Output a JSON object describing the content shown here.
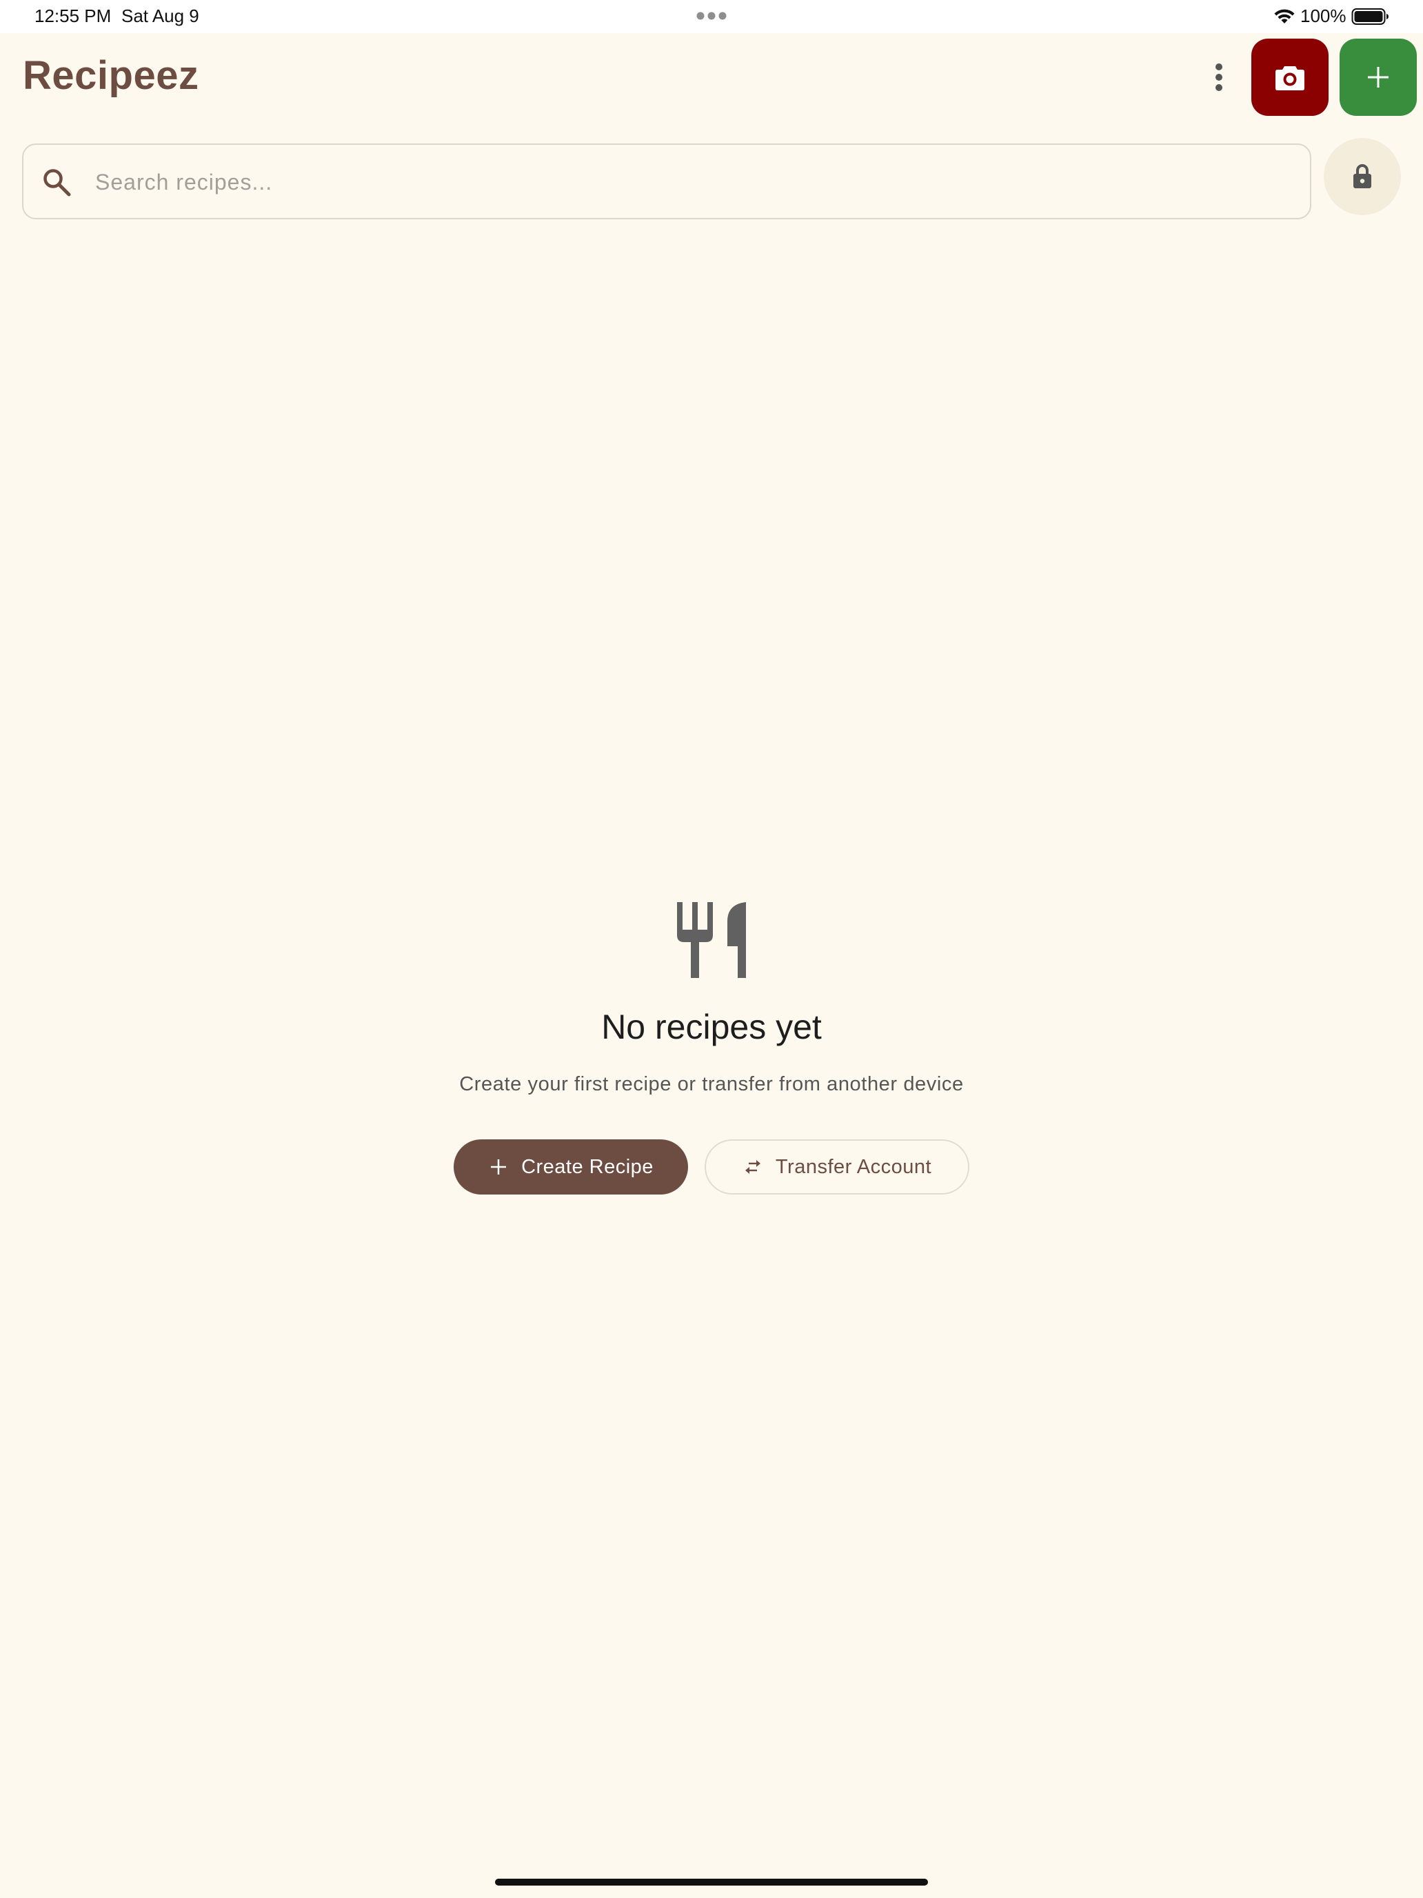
{
  "status_bar": {
    "time": "12:55 PM",
    "date": "Sat Aug 9",
    "battery_percent": "100%"
  },
  "app_bar": {
    "title": "Recipeez",
    "actions": [
      {
        "icon": "more-vert-icon"
      },
      {
        "icon": "camera-icon",
        "color": "#8B0000"
      },
      {
        "icon": "plus-icon",
        "color": "#388E3C"
      }
    ]
  },
  "search": {
    "placeholder": "Search recipes...",
    "value": ""
  },
  "lock": {
    "icon": "lock-icon"
  },
  "empty_state": {
    "icon": "restaurant-icon",
    "title": "No recipes yet",
    "subtitle": "Create your first recipe or transfer from another device",
    "primary_button": {
      "label": "Create Recipe",
      "icon": "plus-icon"
    },
    "secondary_button": {
      "label": "Transfer Account",
      "icon": "swap-horiz-icon"
    }
  },
  "theme": {
    "background": "#FDF9EF",
    "brand": "#6D4C41",
    "camera_accent": "#8B0000",
    "add_accent": "#388E3C"
  }
}
